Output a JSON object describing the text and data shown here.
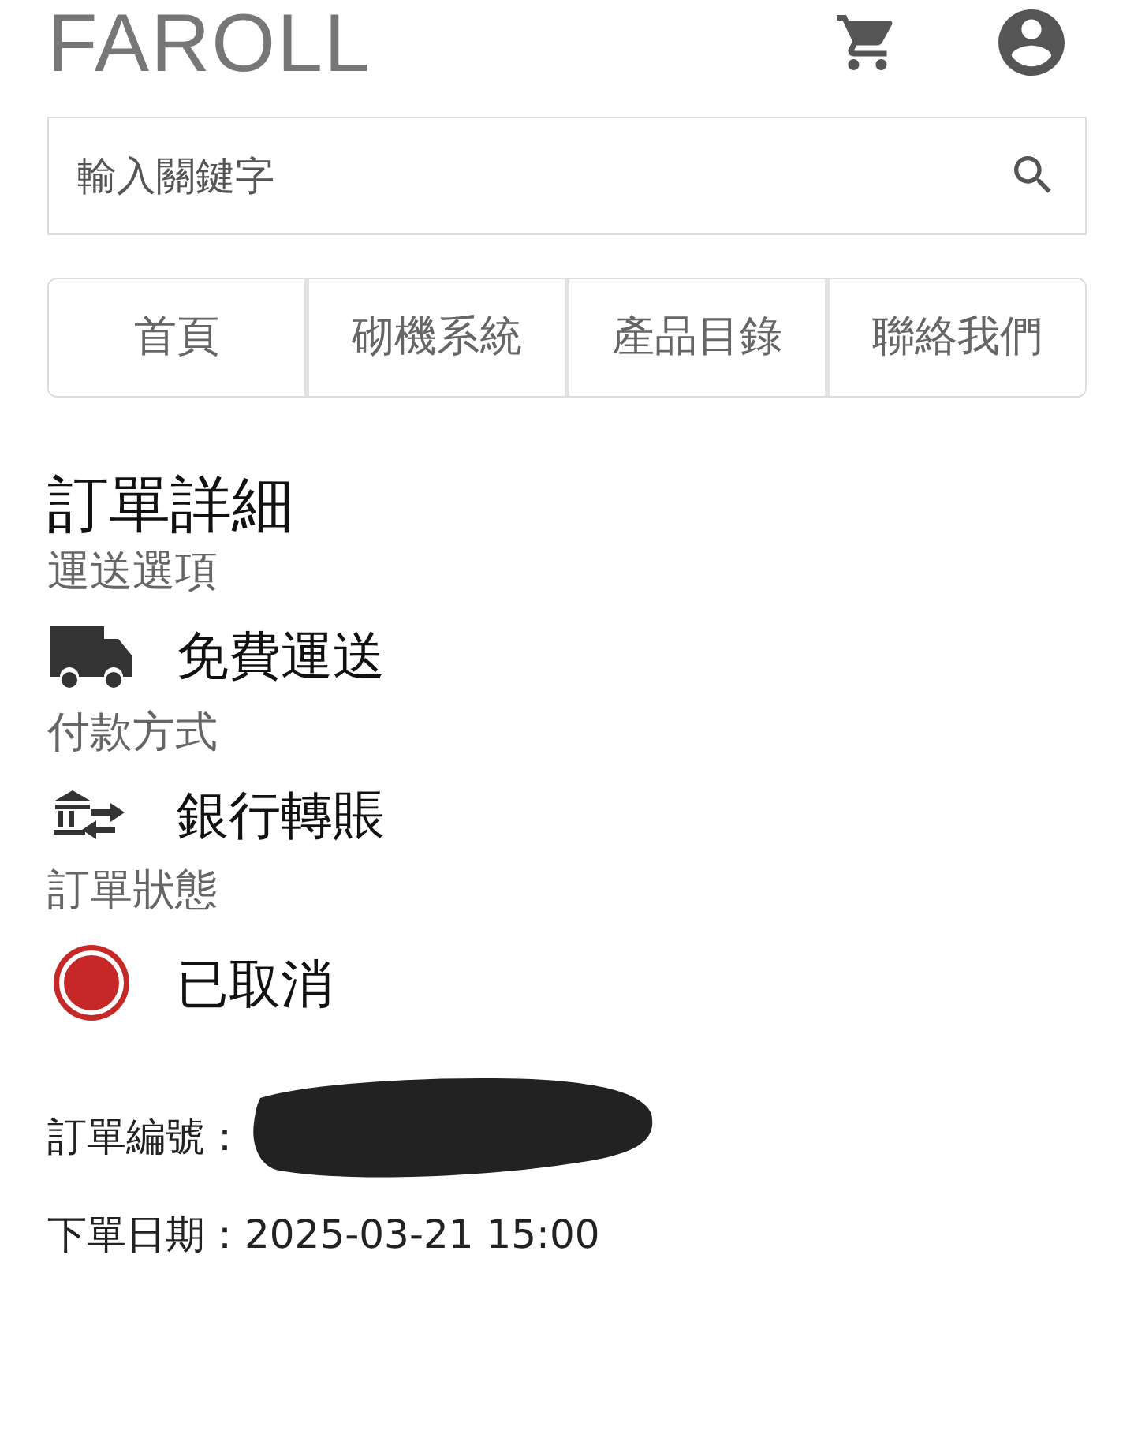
{
  "header": {
    "logo": "FAROLL"
  },
  "search": {
    "placeholder": "輸入關鍵字"
  },
  "nav": [
    {
      "label": "首頁"
    },
    {
      "label": "砌機系統"
    },
    {
      "label": "產品目錄"
    },
    {
      "label": "聯絡我們"
    }
  ],
  "page_title": "訂單詳細",
  "details": [
    {
      "kind": "shipping",
      "label": "運送選項",
      "value": "免費運送"
    },
    {
      "kind": "payment",
      "label": "付款方式",
      "value": "銀行轉賬"
    },
    {
      "kind": "status",
      "label": "訂單狀態",
      "value": "已取消",
      "color": "#c62828"
    }
  ],
  "meta": [
    {
      "kind": "redacted",
      "label": "訂單編號："
    },
    {
      "kind": "text",
      "label": "下單日期：",
      "value": "2025-03-21 15:00"
    }
  ]
}
